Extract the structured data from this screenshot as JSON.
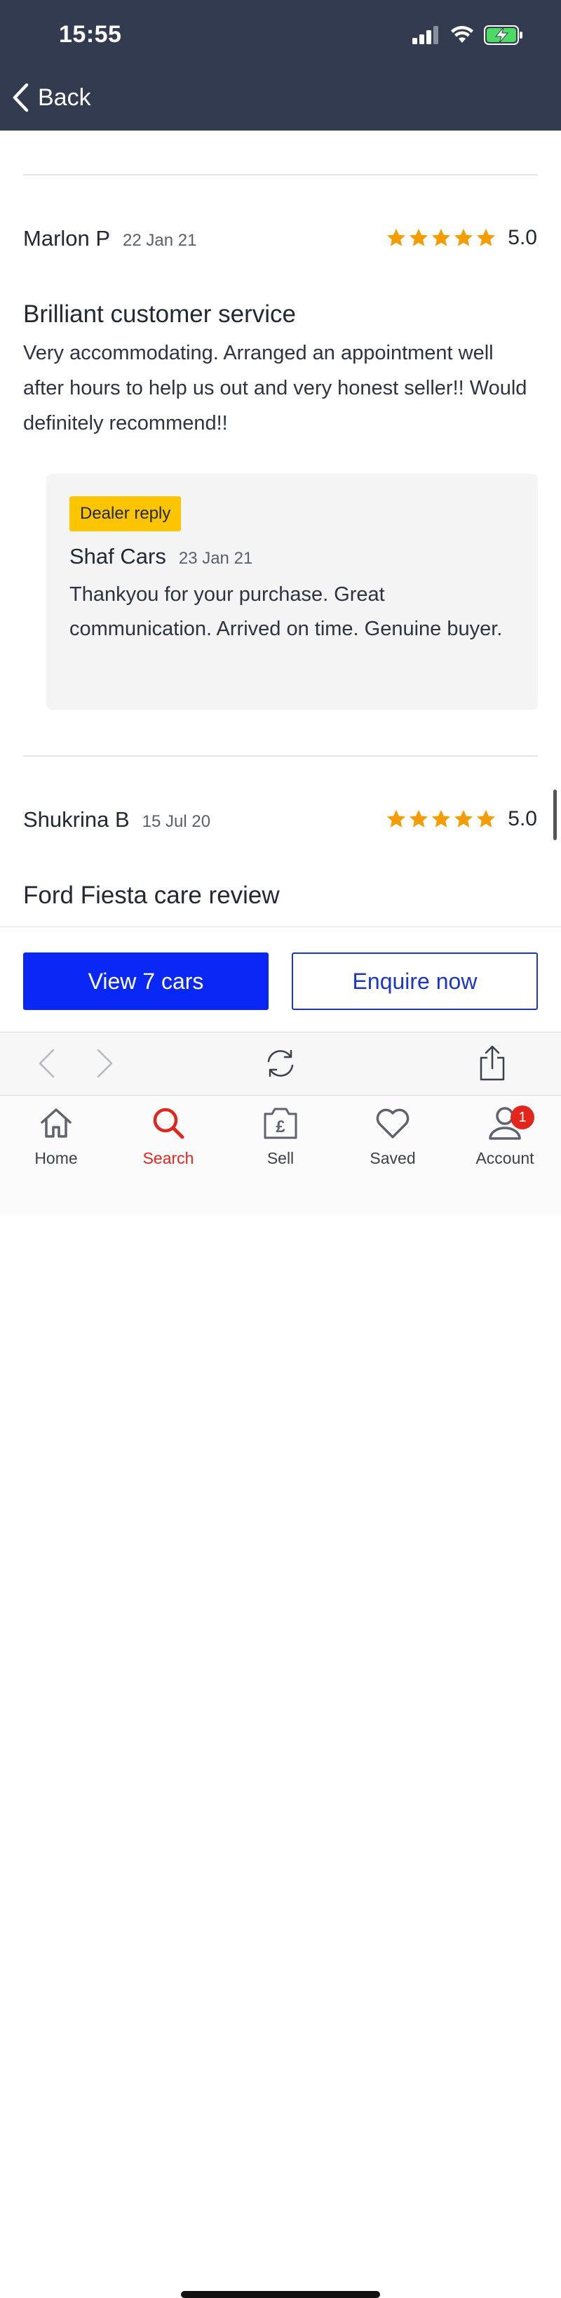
{
  "status_bar": {
    "time": "15:55"
  },
  "header": {
    "back_label": "Back"
  },
  "reviews": [
    {
      "reviewer": "Marlon P",
      "date": "22 Jan 21",
      "rating": "5.0",
      "stars": 5,
      "title": "Brilliant customer service",
      "body": "Very accommodating. Arranged an appointment well after hours to help us out and very honest seller!! Would definitely recommend!!",
      "reply": {
        "badge": "Dealer reply",
        "author": "Shaf Cars",
        "date": "23 Jan 21",
        "text": "Thankyou for your purchase. Great communication. Arrived on time. Genuine buyer."
      }
    },
    {
      "reviewer": "Shukrina B",
      "date": "15 Jul 20",
      "rating": "5.0",
      "stars": 5,
      "title": "Ford Fiesta care review"
    }
  ],
  "cta": {
    "primary_label": "View 7 cars",
    "secondary_label": "Enquire now"
  },
  "tabs": [
    {
      "label": "Home",
      "icon": "home-icon",
      "active": false
    },
    {
      "label": "Search",
      "icon": "search-icon",
      "active": true
    },
    {
      "label": "Sell",
      "icon": "sell-icon",
      "active": false
    },
    {
      "label": "Saved",
      "icon": "heart-icon",
      "active": false
    },
    {
      "label": "Account",
      "icon": "account-icon",
      "active": false,
      "badge": "1"
    }
  ],
  "colors": {
    "header_bg": "#333b51",
    "star": "#f59c00",
    "primary_button": "#0a28f5",
    "badge_yellow": "#fdc500",
    "active_tab": "#e1261c"
  }
}
